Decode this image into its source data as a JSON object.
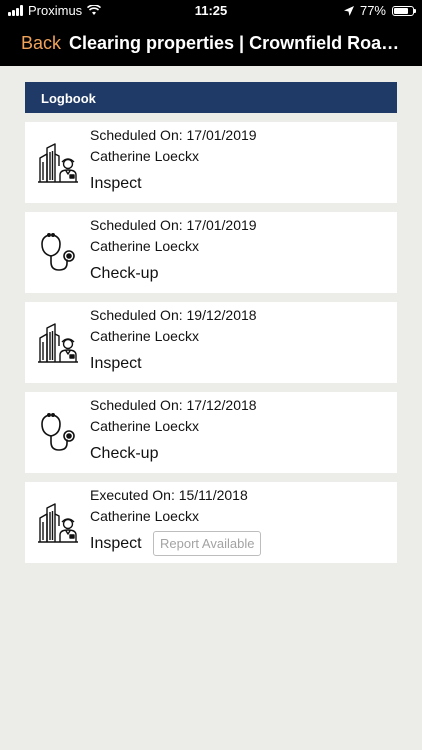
{
  "status": {
    "carrier": "Proximus",
    "time": "11:25",
    "battery": "77%",
    "battery_level": 0.77
  },
  "nav": {
    "back_label": "Back",
    "title": "Clearing properties | Crownfield Road 1..."
  },
  "section": {
    "title": "Logbook"
  },
  "entries": [
    {
      "line1": "Scheduled On: 17/01/2019",
      "person": "Catherine Loeckx",
      "type": "Inspect",
      "icon": "inspector-building-icon"
    },
    {
      "line1": "Scheduled On: 17/01/2019",
      "person": "Catherine Loeckx",
      "type": "Check-up",
      "icon": "stethoscope-icon"
    },
    {
      "line1": "Scheduled On: 19/12/2018",
      "person": "Catherine Loeckx",
      "type": "Inspect",
      "icon": "inspector-building-icon"
    },
    {
      "line1": "Scheduled On: 17/12/2018",
      "person": "Catherine Loeckx",
      "type": "Check-up",
      "icon": "stethoscope-icon"
    },
    {
      "line1": "Executed On: 15/11/2018",
      "person": "Catherine Loeckx",
      "type": "Inspect",
      "icon": "inspector-building-icon",
      "report_label": "Report Available"
    }
  ],
  "colors": {
    "accent": "#f0a35a",
    "header_bg": "#1f3a66",
    "page_bg": "#ecece8"
  }
}
